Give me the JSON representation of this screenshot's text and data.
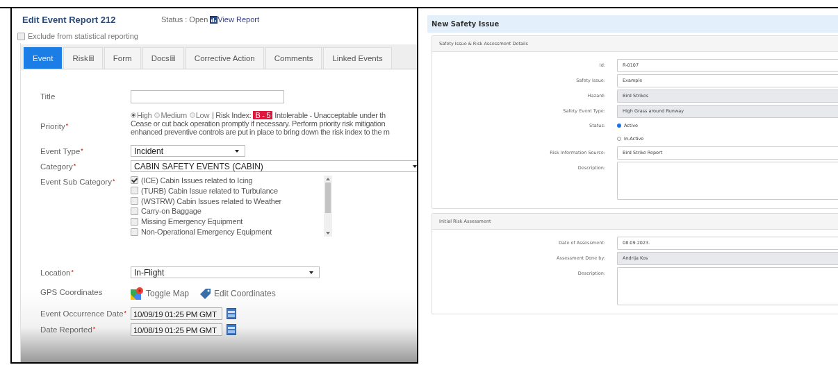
{
  "event_report": {
    "title": "Edit Event Report 212",
    "status": "Status : Open",
    "view_report_link": "View Report",
    "exclude_checkbox": {
      "label": "Exclude from statistical reporting",
      "checked": false
    },
    "tabs": [
      {
        "label": "Event",
        "selected": true,
        "has_icon": false
      },
      {
        "label": "Risk",
        "selected": false,
        "has_icon": true
      },
      {
        "label": "Form",
        "selected": false,
        "has_icon": false
      },
      {
        "label": "Docs",
        "selected": false,
        "has_icon": true
      },
      {
        "label": "Corrective Action",
        "selected": false,
        "has_icon": false
      },
      {
        "label": "Comments",
        "selected": false,
        "has_icon": false
      },
      {
        "label": "Linked Events",
        "selected": false,
        "has_icon": false
      }
    ],
    "fields": [
      {
        "kind": "text",
        "label": "Title"
      },
      {
        "kind": "priority",
        "label": "Priority",
        "required_mark": "*",
        "options": [
          {
            "label": "High",
            "selected": true
          },
          {
            "label": "Medium",
            "selected": false
          },
          {
            "label": "Low",
            "selected": false
          }
        ],
        "risk_index_label": "|  Risk Index:",
        "risk_index": "B - 5",
        "risk_text_lines": [
          "Intolerable - Unacceptable under th",
          "Cease or cut back operation promptly if necessary. Perform priority risk mitigation",
          "enhanced preventive controls are put in place to bring down the risk index to the m"
        ]
      },
      {
        "kind": "select",
        "label": "Event Type",
        "required_mark": "*",
        "value": "Incident"
      },
      {
        "kind": "select",
        "label": "Category",
        "required_mark": "*",
        "value": "CABIN SAFETY EVENTS (CABIN)"
      },
      {
        "kind": "checklist",
        "label": "Event Sub Category",
        "required_mark": "*",
        "items": [
          {
            "label": "(ICE) Cabin Issues related to Icing",
            "checked": true
          },
          {
            "label": "(TURB) Cabin Issue related to Turbulance",
            "checked": false
          },
          {
            "label": "(WSTRW) Cabin Issues related to Weather",
            "checked": false
          },
          {
            "label": "Carry-on Baggage",
            "checked": false
          },
          {
            "label": "Missing Emergency Equipment",
            "checked": false
          },
          {
            "label": "Non-Operational Emergency Equipment",
            "checked": false
          }
        ]
      },
      {
        "kind": "select",
        "label": "Location",
        "required_mark": "*",
        "value": "In-Flight"
      },
      {
        "kind": "gps",
        "label": "GPS Coordinates",
        "actions": [
          "Toggle Map",
          "Edit Coordinates"
        ]
      },
      {
        "kind": "date",
        "label": "Event Occurrence Date",
        "required_mark": "*",
        "value": "10/09/19 01:25 PM GMT"
      },
      {
        "kind": "date",
        "label": "Date Reported",
        "required_mark": "*",
        "value": "10/08/19 01:25 PM GMT"
      }
    ]
  },
  "safety_issue": {
    "title": "New Safety Issue",
    "sections": [
      {
        "heading": "Safety Issue & Risk Assessment Details",
        "fields": [
          {
            "kind": "input",
            "label": "Id:",
            "value": "R-0107",
            "readonly": false
          },
          {
            "kind": "input",
            "label": "Safety Issue:",
            "value": "Example",
            "readonly": false
          },
          {
            "kind": "input",
            "label": "Hazard:",
            "value": "Bird Strikes",
            "readonly": true
          },
          {
            "kind": "input",
            "label": "Safety Event Type:",
            "value": "High Grass around Runway",
            "readonly": true
          },
          {
            "kind": "radio",
            "label": "Status:",
            "options": [
              {
                "label": "Active",
                "selected": true
              },
              {
                "label": "In-Active",
                "selected": false
              }
            ]
          },
          {
            "kind": "input",
            "label": "Risk Information Source:",
            "value": "Bird Strike Report",
            "readonly": false
          },
          {
            "kind": "textarea",
            "label": "Description:"
          }
        ]
      },
      {
        "heading": "Initial Risk Assessment",
        "fields": [
          {
            "kind": "input",
            "label": "Date of Assessment:",
            "value": "08.09.2023.",
            "readonly": false
          },
          {
            "kind": "input",
            "label": "Assessment Done by:",
            "value": "Andrija Kos",
            "readonly": true
          },
          {
            "kind": "textarea",
            "label": "Description:"
          }
        ]
      }
    ]
  }
}
